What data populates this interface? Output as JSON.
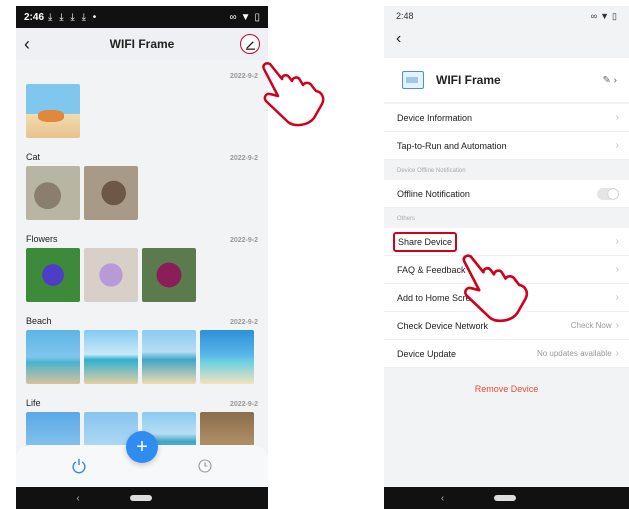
{
  "left_phone": {
    "status": {
      "time": "2:46",
      "download_icons": "⤓ ⤓ ⤓ ⤓ •"
    },
    "header": {
      "title": "WIFI Frame"
    },
    "albums": [
      {
        "name": "",
        "date": "2022-9-2"
      },
      {
        "name": "Cat",
        "date": "2022-9-2"
      },
      {
        "name": "Flowers",
        "date": "2022-9-2"
      },
      {
        "name": "Beach",
        "date": "2022-9-2"
      },
      {
        "name": "Life",
        "date": "2022-9-2"
      }
    ],
    "fab_label": "+"
  },
  "right_phone": {
    "status": {
      "time": "2:48"
    },
    "device_name": "WIFI Frame",
    "rows": {
      "device_information": "Device Information",
      "tap_to_run": "Tap-to-Run and Automation",
      "offline_section": "Device Offline Notification",
      "offline_notification": "Offline Notification",
      "others_section": "Others",
      "share_device": "Share Device",
      "faq": "FAQ & Feedback",
      "add_home": "Add to Home Screen",
      "check_network": "Check Device Network",
      "check_network_value": "Check Now",
      "device_update": "Device Update",
      "device_update_value": "No updates available"
    },
    "remove_device": "Remove Device"
  },
  "colors": {
    "accent_red": "#d0011b",
    "fab_blue": "#2f8cf0",
    "remove_red": "#e94b3c"
  }
}
